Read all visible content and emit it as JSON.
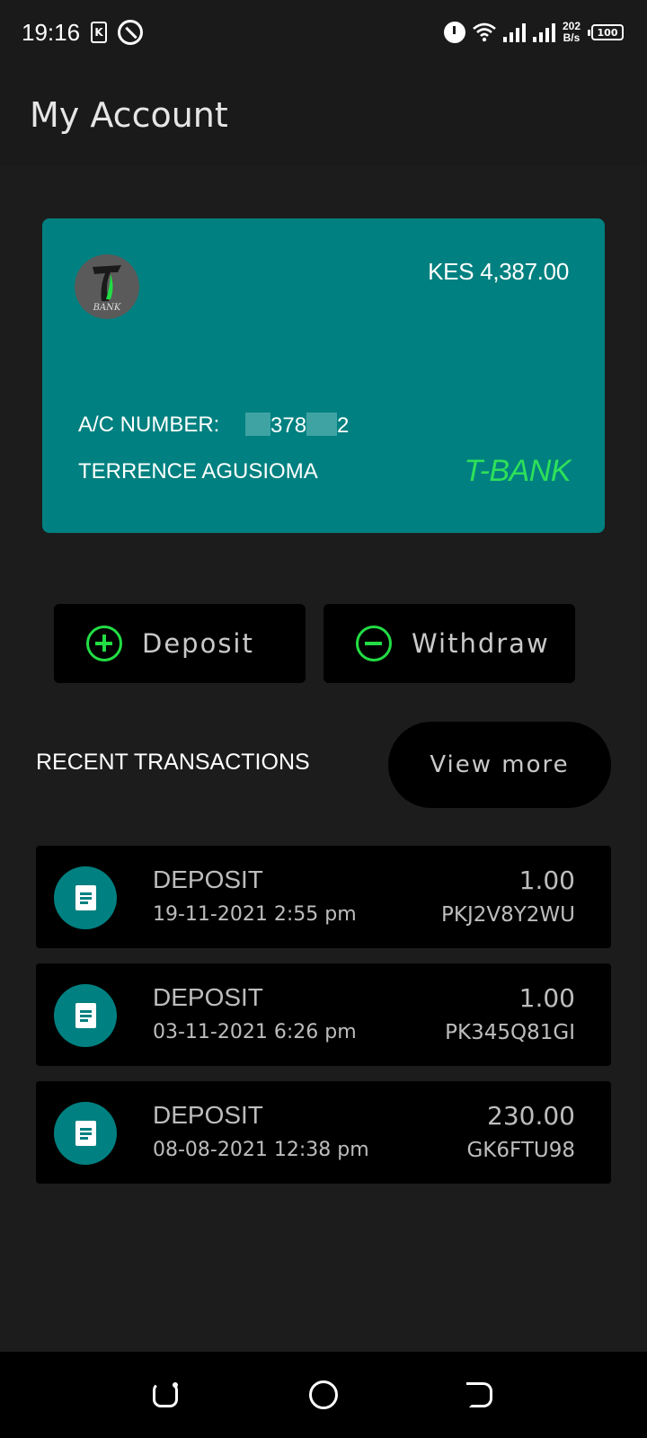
{
  "status_bar": {
    "time": "19:16",
    "k_icon_text": "K",
    "net_speed_value": "202",
    "net_speed_unit": "B/s",
    "battery": "100"
  },
  "app_bar": {
    "title": "My Account"
  },
  "card": {
    "balance": "KES 4,387.00",
    "logo_text": "BANK",
    "account_label": "A/C NUMBER:",
    "account_number_visible_1": "378",
    "account_number_visible_2": "2",
    "holder_name": "TERRENCE AGUSIOMA",
    "bank_name": "T-BANK",
    "card_color": "#008080",
    "bank_name_color": "#2ee05a"
  },
  "actions": {
    "deposit_label": "Deposit",
    "withdraw_label": "Withdraw",
    "icon_color": "#22dd44"
  },
  "recent": {
    "title": "RECENT TRANSACTIONS",
    "view_more_label": "View more"
  },
  "transactions": [
    {
      "type": "DEPOSIT",
      "date": "19-11-2021 2:55 pm",
      "amount": "1.00",
      "ref": "PKJ2V8Y2WU"
    },
    {
      "type": "DEPOSIT",
      "date": "03-11-2021 6:26 pm",
      "amount": "1.00",
      "ref": "PK345Q81GI"
    },
    {
      "type": "DEPOSIT",
      "date": "08-08-2021 12:38 pm",
      "amount": "230.00",
      "ref": "GK6FTU98"
    }
  ],
  "icons": {
    "status": [
      "sim-k-icon",
      "sync-ring-icon",
      "alarm-icon",
      "wifi-icon",
      "signal-icon",
      "battery-icon"
    ],
    "transaction": "receipt-icon",
    "nav": [
      "recent-apps-icon",
      "home-icon",
      "back-icon"
    ]
  }
}
